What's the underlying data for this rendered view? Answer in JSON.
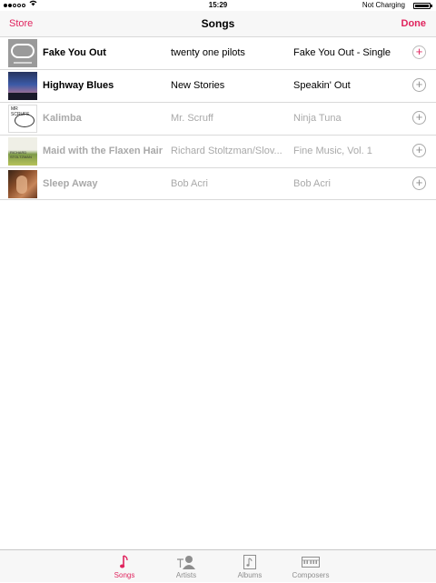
{
  "status_bar": {
    "time": "15:29",
    "charging_text": "Not Charging"
  },
  "nav": {
    "left_label": "Store",
    "title": "Songs",
    "right_label": "Done"
  },
  "songs": [
    {
      "title": "Fake You Out",
      "artist": "twenty one pilots",
      "album": "Fake You Out - Single",
      "add": "+",
      "art_text": ""
    },
    {
      "title": "Highway Blues",
      "artist": "New Stories",
      "album": "Speakin' Out",
      "add": "+",
      "art_text": ""
    },
    {
      "title": "Kalimba",
      "artist": "Mr. Scruff",
      "album": "Ninja Tuna",
      "add": "+",
      "art_text": "MR SCRUFF"
    },
    {
      "title": "Maid with the Flaxen Hair",
      "artist": "Richard Stoltzman/Slov...",
      "album": "Fine Music, Vol. 1",
      "add": "+",
      "art_text": "RICHARD STOLTZMAN"
    },
    {
      "title": "Sleep Away",
      "artist": "Bob Acri",
      "album": "Bob Acri",
      "add": "+",
      "art_text": ""
    }
  ],
  "tabs": [
    {
      "label": "Songs",
      "icon": "music-note-icon"
    },
    {
      "label": "Artists",
      "icon": "artist-icon"
    },
    {
      "label": "Albums",
      "icon": "album-icon"
    },
    {
      "label": "Composers",
      "icon": "piano-icon"
    }
  ],
  "colors": {
    "accent": "#e0245e",
    "dim_text": "#a9a9a9",
    "bar_background": "#f7f7f7"
  }
}
